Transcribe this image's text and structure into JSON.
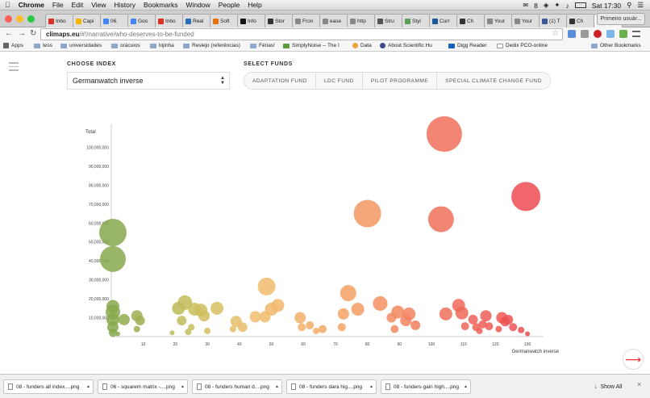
{
  "menubar": {
    "app": "Chrome",
    "menus": [
      "File",
      "Edit",
      "View",
      "History",
      "Bookmarks",
      "Window",
      "People",
      "Help"
    ],
    "badge": "8",
    "clock": "Sat 17:30"
  },
  "tabs": [
    {
      "label": "Inbo",
      "color": "#d93025"
    },
    {
      "label": "Capi",
      "color": "#f4b400"
    },
    {
      "label": "06.",
      "color": "#4285f4"
    },
    {
      "label": "Goo",
      "color": "#4285f4"
    },
    {
      "label": "Inbo",
      "color": "#d93025"
    },
    {
      "label": "Real",
      "color": "#2a6ebb"
    },
    {
      "label": "Soft",
      "color": "#e8710a"
    },
    {
      "label": "Info",
      "color": "#111111"
    },
    {
      "label": "Stor",
      "color": "#333333"
    },
    {
      "label": "Fron",
      "color": "#888888"
    },
    {
      "label": "ease",
      "color": "#888888"
    },
    {
      "label": "http",
      "color": "#888888"
    },
    {
      "label": "Stru",
      "color": "#555555"
    },
    {
      "label": "Styl",
      "color": "#5aa05a"
    },
    {
      "label": "Curr",
      "color": "#1a5a9a"
    },
    {
      "label": "Ch",
      "color": "#333333"
    },
    {
      "label": "Your",
      "color": "#888888"
    },
    {
      "label": "Your",
      "color": "#888888"
    },
    {
      "label": "(1) T",
      "color": "#3b5998"
    },
    {
      "label": "Ch",
      "color": "#333333"
    },
    {
      "label": "C",
      "color": "#e84c3d"
    }
  ],
  "user_button": "Primeiro usuár...",
  "omnibox": {
    "host": "climaps.eu",
    "path": "/#!/narrative/who-deserves-to-be-funded"
  },
  "bookmarks": [
    "Apps",
    "tess",
    "universidades",
    "orácuios",
    "lojinha",
    "Reslejo (referências)",
    "Férias!",
    "SimplyNoise -- The I",
    "Data",
    "About Scientific Hu",
    "Digg Reader",
    "Dedix PCO-online",
    "Other Bookmarks"
  ],
  "page": {
    "choose_index_label": "CHOOSE INDEX",
    "index_value": "Germanwatch inverse",
    "select_funds_label": "SELECT FUNDS",
    "funds": [
      "ADAPTATION FUND",
      "LDC FUND",
      "PILOT PROGRAMME",
      "SPECIAL CLIMATE CHANGE FUND"
    ]
  },
  "downloads": [
    "08 - funders all index....png",
    "06 - squarem matrix -....png",
    "08 - funders human d....png",
    "08 - funders dara hig....png",
    "08 - funders gain high....png"
  ],
  "show_all": "Show All",
  "chart_data": {
    "type": "scatter",
    "ylabel": "Total",
    "xlabel": "Germanwatch inverse",
    "xlim": [
      0,
      133
    ],
    "ylim": [
      0,
      110000000
    ],
    "xticks": [
      10,
      20,
      30,
      40,
      50,
      60,
      70,
      80,
      90,
      100,
      110,
      120,
      130
    ],
    "yticks": [
      10000000,
      20000000,
      30000000,
      40000000,
      50000000,
      60000000,
      70000000,
      80000000,
      90000000,
      100000000
    ],
    "ytick_labels": [
      "10,000,000",
      "20,000,000",
      "30,000,000",
      "40,000,000",
      "50,000,000",
      "60,000,000",
      "70,000,000",
      "80,000,000",
      "90,000,000",
      "100,000,000"
    ],
    "points": [
      {
        "x": 0.5,
        "y": 55000000,
        "size": 17
      },
      {
        "x": 0.5,
        "y": 41000000,
        "size": 16
      },
      {
        "x": 0.5,
        "y": 16000000,
        "size": 8
      },
      {
        "x": 0.5,
        "y": 13000000,
        "size": 9
      },
      {
        "x": 0.5,
        "y": 9000000,
        "size": 8
      },
      {
        "x": 0.5,
        "y": 5000000,
        "size": 7
      },
      {
        "x": 0.5,
        "y": 2000000,
        "size": 5
      },
      {
        "x": 2,
        "y": 1500000,
        "size": 3
      },
      {
        "x": 4,
        "y": 9000000,
        "size": 7
      },
      {
        "x": 8,
        "y": 11000000,
        "size": 7
      },
      {
        "x": 9,
        "y": 8500000,
        "size": 6
      },
      {
        "x": 8,
        "y": 4000000,
        "size": 4
      },
      {
        "x": 19,
        "y": 2000000,
        "size": 3
      },
      {
        "x": 21,
        "y": 15000000,
        "size": 8
      },
      {
        "x": 22,
        "y": 8500000,
        "size": 6
      },
      {
        "x": 23,
        "y": 18000000,
        "size": 9
      },
      {
        "x": 24,
        "y": 2500000,
        "size": 4
      },
      {
        "x": 25,
        "y": 5000000,
        "size": 4
      },
      {
        "x": 26,
        "y": 14500000,
        "size": 8
      },
      {
        "x": 28,
        "y": 14000000,
        "size": 8
      },
      {
        "x": 29,
        "y": 11000000,
        "size": 7
      },
      {
        "x": 30,
        "y": 3000000,
        "size": 4
      },
      {
        "x": 33,
        "y": 15000000,
        "size": 8
      },
      {
        "x": 38,
        "y": 4000000,
        "size": 4
      },
      {
        "x": 39,
        "y": 8000000,
        "size": 7
      },
      {
        "x": 41,
        "y": 5000000,
        "size": 6
      },
      {
        "x": 45,
        "y": 10500000,
        "size": 7
      },
      {
        "x": 48,
        "y": 10500000,
        "size": 7
      },
      {
        "x": 48.5,
        "y": 26500000,
        "size": 11
      },
      {
        "x": 50,
        "y": 14500000,
        "size": 8
      },
      {
        "x": 52,
        "y": 16500000,
        "size": 8
      },
      {
        "x": 59,
        "y": 10000000,
        "size": 7
      },
      {
        "x": 59.5,
        "y": 5000000,
        "size": 5
      },
      {
        "x": 62,
        "y": 6000000,
        "size": 5
      },
      {
        "x": 64,
        "y": 3000000,
        "size": 4
      },
      {
        "x": 66,
        "y": 4000000,
        "size": 5
      },
      {
        "x": 72,
        "y": 5000000,
        "size": 5
      },
      {
        "x": 72.5,
        "y": 12000000,
        "size": 7
      },
      {
        "x": 74,
        "y": 23000000,
        "size": 10
      },
      {
        "x": 77,
        "y": 14500000,
        "size": 8
      },
      {
        "x": 80,
        "y": 65000000,
        "size": 17
      },
      {
        "x": 84,
        "y": 17500000,
        "size": 9
      },
      {
        "x": 87.5,
        "y": 10000000,
        "size": 6
      },
      {
        "x": 88.5,
        "y": 4000000,
        "size": 5
      },
      {
        "x": 89.5,
        "y": 13000000,
        "size": 8
      },
      {
        "x": 92,
        "y": 8500000,
        "size": 7
      },
      {
        "x": 93,
        "y": 12000000,
        "size": 8
      },
      {
        "x": 95,
        "y": 6000000,
        "size": 6
      },
      {
        "x": 103,
        "y": 62000000,
        "size": 16
      },
      {
        "x": 104,
        "y": 107000000,
        "size": 22
      },
      {
        "x": 104.5,
        "y": 12000000,
        "size": 8
      },
      {
        "x": 108.5,
        "y": 16500000,
        "size": 8
      },
      {
        "x": 109.5,
        "y": 12500000,
        "size": 8
      },
      {
        "x": 110.5,
        "y": 5500000,
        "size": 5
      },
      {
        "x": 113,
        "y": 9000000,
        "size": 6
      },
      {
        "x": 114,
        "y": 5000000,
        "size": 5
      },
      {
        "x": 115,
        "y": 3000000,
        "size": 4
      },
      {
        "x": 116,
        "y": 6500000,
        "size": 5
      },
      {
        "x": 117,
        "y": 11000000,
        "size": 7
      },
      {
        "x": 118,
        "y": 5500000,
        "size": 5
      },
      {
        "x": 121,
        "y": 4000000,
        "size": 4
      },
      {
        "x": 122,
        "y": 10000000,
        "size": 7
      },
      {
        "x": 123,
        "y": 8000000,
        "size": 6
      },
      {
        "x": 124,
        "y": 9000000,
        "size": 6
      },
      {
        "x": 125.5,
        "y": 5000000,
        "size": 5
      },
      {
        "x": 129.5,
        "y": 74000000,
        "size": 18
      },
      {
        "x": 128,
        "y": 3500000,
        "size": 4
      },
      {
        "x": 130,
        "y": 1500000,
        "size": 3
      }
    ],
    "grid": false,
    "legend": "none"
  }
}
